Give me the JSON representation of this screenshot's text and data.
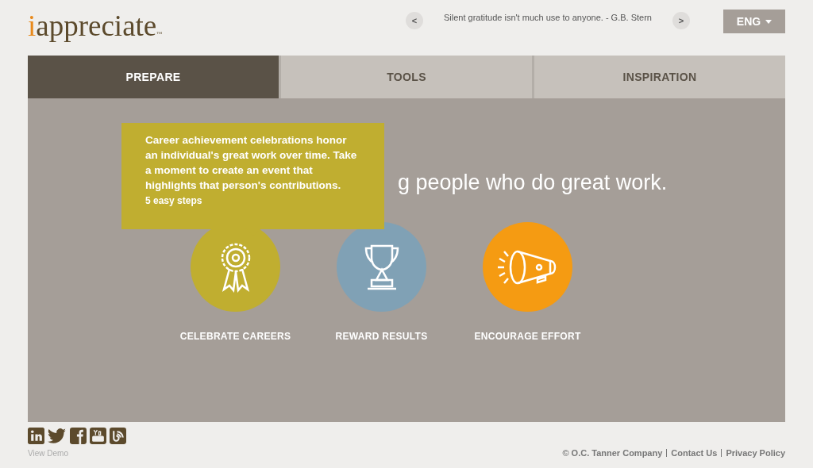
{
  "logo": {
    "accent": "i",
    "name": "appreciate",
    "mark": "™"
  },
  "quote": {
    "text": "Silent gratitude isn't much use to anyone. - G.B. Stern",
    "prev": "<",
    "next": ">"
  },
  "language": {
    "label": "ENG"
  },
  "tabs": [
    {
      "label": "PREPARE",
      "selected": true
    },
    {
      "label": "TOOLS",
      "selected": false
    },
    {
      "label": "INSPIRATION",
      "selected": false
    }
  ],
  "headline": "g people who do great work.",
  "tooltip": {
    "text": "Career achievement celebrations honor an individual's great work over time. Take a moment to create an event that highlights that person's contributions.",
    "link": "5 easy steps"
  },
  "actions": [
    {
      "kind": "award",
      "label": "CELEBRATE CAREERS",
      "color": "#c0ae30"
    },
    {
      "kind": "trophy",
      "label": "REWARD RESULTS",
      "color": "#80a1b5"
    },
    {
      "kind": "megaphone",
      "label": "ENCOURAGE EFFORT",
      "color": "#f59b12"
    }
  ],
  "social": [
    {
      "kind": "linkedin"
    },
    {
      "kind": "twitter"
    },
    {
      "kind": "facebook"
    },
    {
      "kind": "youtube"
    },
    {
      "kind": "blog"
    }
  ],
  "view_demo": "View Demo",
  "footer": {
    "copyright": "© O.C. Tanner Company",
    "links": [
      "Contact Us",
      "Privacy Policy"
    ]
  }
}
